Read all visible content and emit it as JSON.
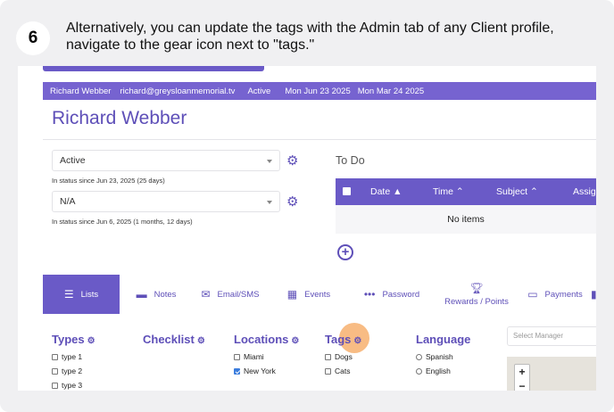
{
  "step": {
    "number": "6",
    "text": "Alternatively, you can update the tags with the Admin tab of any Client profile, navigate to the gear icon next to \"tags.\""
  },
  "client_bar": {
    "name": "Richard Webber",
    "email": "richard@greysloanmemorial.tv",
    "status": "Active",
    "date1": "Mon Jun 23 2025",
    "date2": "Mon Mar 24 2025"
  },
  "client_name": "Richard Webber",
  "status_select": {
    "value": "Active",
    "since": "In status since Jun 23, 2025 (25 days)"
  },
  "na_select": {
    "value": "N/A",
    "since": "In status since Jun 6, 2025 (1 months, 12 days)"
  },
  "todo": {
    "title": "To Do",
    "columns": [
      "Date ▲",
      "Time ⌃",
      "Subject ⌃",
      "Assig"
    ],
    "empty": "No items"
  },
  "tabs": [
    {
      "label": "Lists",
      "icon": "list-icon"
    },
    {
      "label": "Notes",
      "icon": "note-icon"
    },
    {
      "label": "Email/SMS",
      "icon": "envelope-icon"
    },
    {
      "label": "Events",
      "icon": "calendar-icon"
    },
    {
      "label": "Password",
      "icon": "password-icon"
    },
    {
      "label": "Rewards / Points",
      "icon": "trophy-icon"
    },
    {
      "label": "Payments",
      "icon": "credit-card-icon"
    }
  ],
  "lists": {
    "types": {
      "title": "Types",
      "options": [
        "type 1",
        "type 2",
        "type 3"
      ]
    },
    "checklist": {
      "title": "Checklist"
    },
    "locations": {
      "title": "Locations",
      "options": [
        "Miami",
        "New York"
      ],
      "checked": [
        false,
        true
      ]
    },
    "tags": {
      "title": "Tags",
      "options": [
        "Dogs",
        "Cats"
      ]
    },
    "language": {
      "title": "Language",
      "options": [
        "Spanish",
        "English"
      ]
    }
  },
  "manager_placeholder": "Select Manager",
  "colors": {
    "accent": "#6a5ac7",
    "title": "#5e4fb8",
    "highlight": "#f5a050"
  }
}
